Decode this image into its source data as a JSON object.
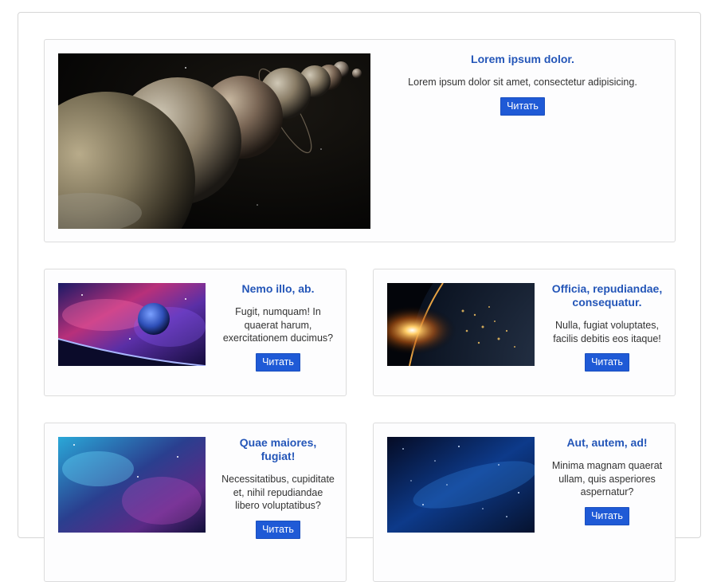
{
  "featured": {
    "title": "Lorem ipsum dolor.",
    "description": "Lorem ipsum dolor sit amet, consectetur adipisicing.",
    "button_label": "Читать",
    "image": "planets-lineup-image"
  },
  "cards": [
    {
      "title": "Nemo illo, ab.",
      "description": "Fugit, numquam! In quaerat harum, exercitationem ducimus?",
      "button_label": "Читать",
      "image": "pink-nebula-planet-image"
    },
    {
      "title": "Officia, repudiandae, consequatur.",
      "description": "Nulla, fugiat voluptates, facilis debitis eos itaque!",
      "button_label": "Читать",
      "image": "earth-sunrise-image"
    },
    {
      "title": "Quae maiores, fugiat!",
      "description": "Necessitatibus, cupiditate et, nihil repudiandae libero voluptatibus?",
      "button_label": "Читать",
      "image": "blue-nebula-image"
    },
    {
      "title": "Aut, autem, ad!",
      "description": "Minima magnam quaerat ullam, quis asperiores aspernatur?",
      "button_label": "Читать",
      "image": "starfield-image"
    }
  ],
  "colors": {
    "title": "#2456b8",
    "button": "#1f5ad6",
    "button_text": "#ffffff",
    "border": "#dcdcdc"
  }
}
